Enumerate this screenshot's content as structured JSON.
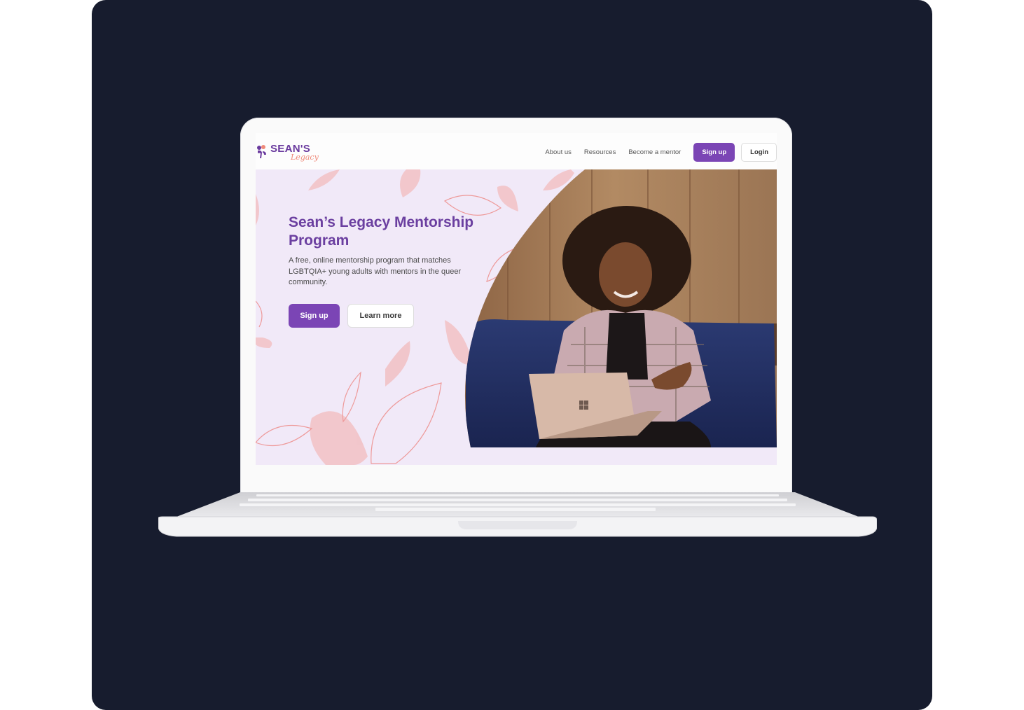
{
  "brand": {
    "name": "SEAN'S",
    "script": "Legacy"
  },
  "nav": {
    "links": [
      "About us",
      "Resources",
      "Become a mentor"
    ],
    "signup_label": "Sign up",
    "login_label": "Login"
  },
  "hero": {
    "title": "Sean’s Legacy Mentorship Program",
    "description": "A free, online mentorship program that matches LGBTQIA+ young adults with mentors in the queer community.",
    "primary_cta": "Sign up",
    "secondary_cta": "Learn more"
  },
  "colors": {
    "backdrop": "#171c2e",
    "brand_purple": "#7b45b5",
    "hero_bg": "#f1e9f8",
    "leaf_pink": "#f2c3c7",
    "leaf_outline": "#ee9a9a"
  },
  "icons": {
    "logo_mark": "flower-logo-icon",
    "laptop_logo": "windows-logo-icon"
  }
}
